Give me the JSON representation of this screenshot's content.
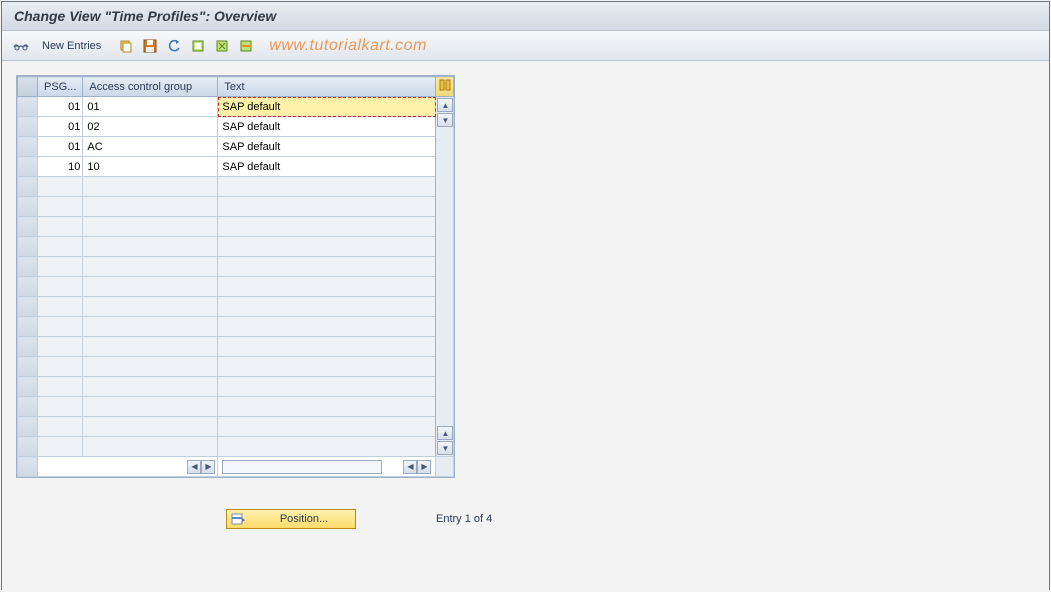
{
  "title": "Change View \"Time Profiles\": Overview",
  "toolbar": {
    "new_entries": "New Entries"
  },
  "watermark": "www.tutorialkart.com",
  "grid": {
    "headers": {
      "psg": "PSG...",
      "acg": "Access control group",
      "text": "Text"
    },
    "rows": [
      {
        "psg": "01",
        "acg": "01",
        "text": "SAP default",
        "selected": true
      },
      {
        "psg": "01",
        "acg": "02",
        "text": "SAP default",
        "selected": false
      },
      {
        "psg": "01",
        "acg": "AC",
        "text": "SAP default",
        "selected": false
      },
      {
        "psg": "10",
        "acg": "10",
        "text": "SAP default",
        "selected": false
      }
    ],
    "empty_rows": 14
  },
  "footer": {
    "position_label": "Position...",
    "entry_text": "Entry 1 of 4"
  }
}
